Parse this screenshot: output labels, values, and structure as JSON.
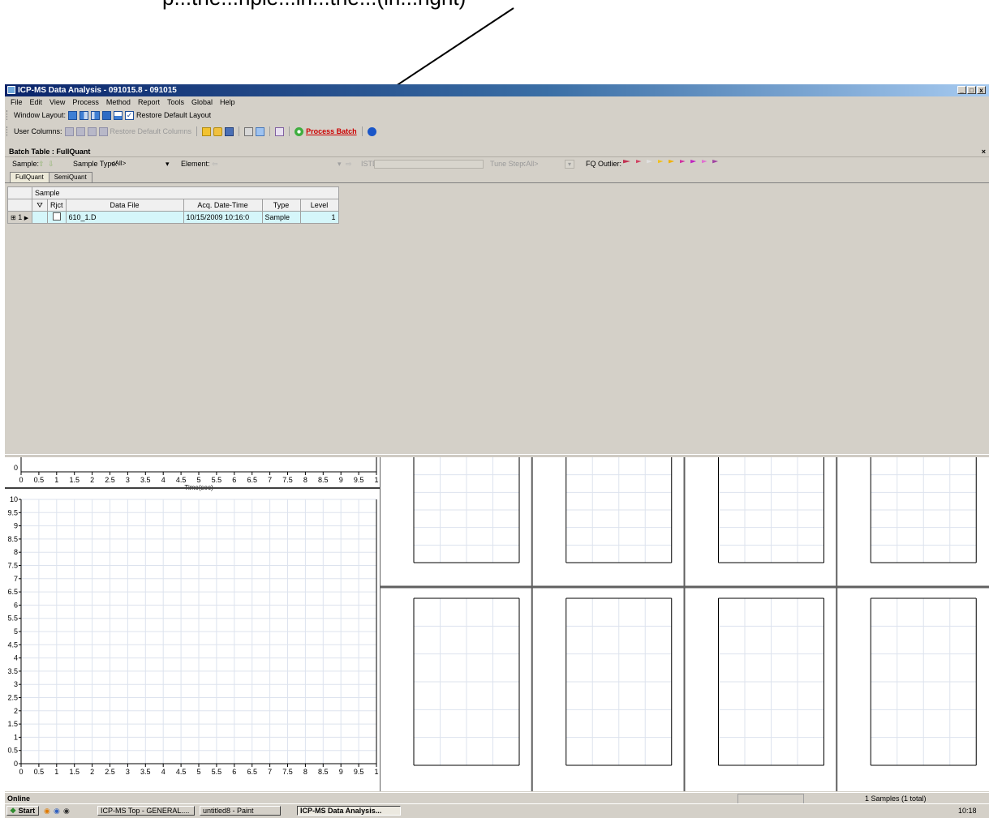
{
  "caption": "p...the...nple...in...the...(in...right)",
  "window": {
    "title": "ICP-MS Data Analysis - 091015.8 - 091015",
    "buttons": [
      "_",
      "□",
      "x"
    ]
  },
  "menu": [
    "File",
    "Edit",
    "View",
    "Process",
    "Method",
    "Report",
    "Tools",
    "Global",
    "Help"
  ],
  "toolbar_layout": {
    "label": "Window Layout:",
    "restore": "Restore Default Layout"
  },
  "toolbar_columns": {
    "label": "User Columns:",
    "restore": "Restore Default Columns",
    "process": "Process Batch"
  },
  "batch_table": {
    "title": "Batch Table : FullQuant"
  },
  "filter": {
    "sample": "Sample:",
    "sample_type": "Sample Type:",
    "sample_type_value": "<All>",
    "element": "Element:",
    "istd": "ISTD:",
    "tune_step": "Tune Step:",
    "tune_value": "<All>",
    "fq_outlier": "FQ Outlier:"
  },
  "tabs": [
    "FullQuant",
    "SemiQuant"
  ],
  "table": {
    "group_header": "Sample",
    "columns": [
      "Rjct",
      "Data File",
      "Acq. Date-Time",
      "Type",
      "Level"
    ],
    "row": {
      "num": "1",
      "data_file": "610_1.D",
      "acq_datetime": "10/15/2009 10:16:0",
      "type": "Sample",
      "level": "1"
    }
  },
  "chart_top": {
    "ylabel_zero": "0",
    "xticks": [
      "0",
      "0.5",
      "1",
      "1.5",
      "2",
      "2.5",
      "3",
      "3.5",
      "4",
      "4.5",
      "5",
      "5.5",
      "6",
      "6.5",
      "7",
      "7.5",
      "8",
      "8.5",
      "9",
      "9.5",
      "1"
    ],
    "xlabel": "Time(sec)"
  },
  "chart_data": {
    "type": "line",
    "x": [],
    "series": [],
    "xlabel": "",
    "ylabel": "",
    "yticks": [
      "10",
      "9.5",
      "9",
      "8.5",
      "8",
      "7.5",
      "7",
      "6.5",
      "6",
      "5.5",
      "5",
      "4.5",
      "4",
      "3.5",
      "3",
      "2.5",
      "2",
      "1.5",
      "1",
      "0.5",
      "0"
    ],
    "xticks": [
      "0",
      "0.5",
      "1",
      "1.5",
      "2",
      "2.5",
      "3",
      "3.5",
      "4",
      "4.5",
      "5",
      "5.5",
      "6",
      "6.5",
      "7",
      "7.5",
      "8",
      "8.5",
      "9",
      "9.5",
      "1"
    ],
    "xlim": [
      0,
      10
    ],
    "ylim": [
      0,
      10
    ],
    "grid": true
  },
  "status": {
    "left": "Online",
    "right": "1 Samples (1 total)"
  },
  "taskbar": {
    "start": "Start",
    "tasks": [
      "ICP-MS Top - GENERAL....",
      "untitled8 - Paint",
      "ICP-MS Data Analysis..."
    ],
    "clock": "10:18"
  },
  "colors": {
    "title_start": "#0a246a",
    "title_end": "#a6caf0",
    "selected_row": "#d5f6fa",
    "process": "#cc0000"
  }
}
